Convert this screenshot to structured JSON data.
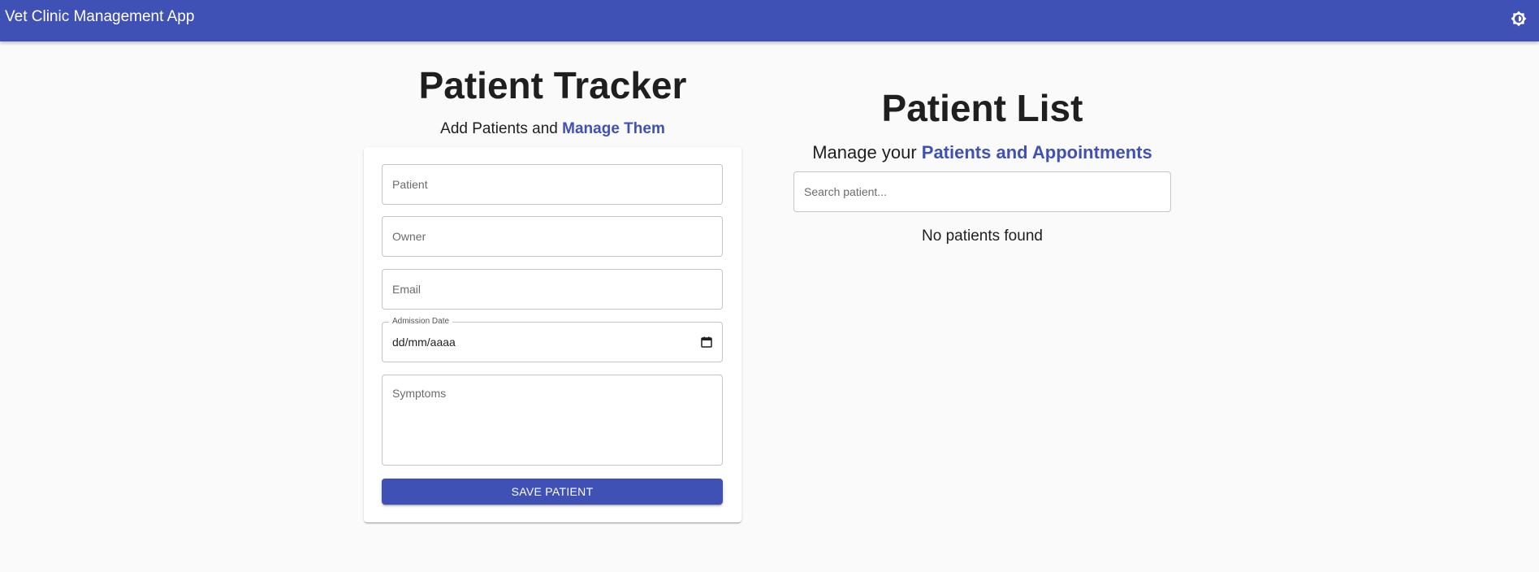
{
  "app": {
    "title": "Vet Clinic Management App",
    "theme_toggle_icon": "brightness-icon",
    "colors": {
      "primary": "#3f51b5",
      "background": "#fafafa",
      "card": "#ffffff",
      "text": "#1f1f1f"
    }
  },
  "form_panel": {
    "heading": "Patient Tracker",
    "subtitle_prefix": "Add Patients and ",
    "subtitle_accent": "Manage Them",
    "fields": {
      "patient_placeholder": "Patient",
      "owner_placeholder": "Owner",
      "email_placeholder": "Email",
      "admission_label": "Admission Date",
      "admission_value": "dd/mm/aaaa",
      "symptoms_placeholder": "Symptoms"
    },
    "save_label": "SAVE PATIENT"
  },
  "list_panel": {
    "heading": "Patient List",
    "subtitle_prefix": "Manage your ",
    "subtitle_accent": "Patients and Appointments",
    "search_placeholder": "Search patient...",
    "empty_message": "No patients found"
  }
}
